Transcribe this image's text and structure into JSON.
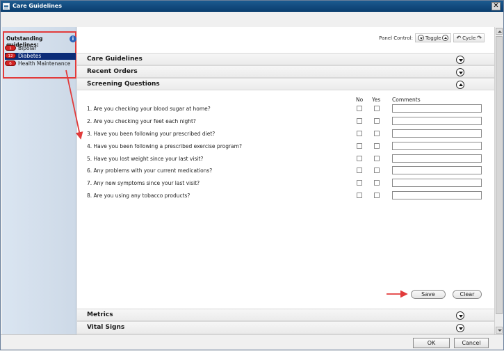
{
  "window": {
    "title": "Care Guidelines",
    "close_glyph": "✕"
  },
  "sidebar": {
    "header": "Outstanding guidelines:",
    "info_glyph": "i",
    "items": [
      {
        "count": "1",
        "label": "Bipolar",
        "selected": false
      },
      {
        "count": "12",
        "label": "Diabetes",
        "selected": true
      },
      {
        "count": "6",
        "label": "Health Maintenance",
        "selected": false
      }
    ]
  },
  "panel_control": {
    "label": "Panel Control:",
    "toggle": "Toggle",
    "cycle": "Cycle"
  },
  "sections": {
    "care_guidelines": "Care Guidelines",
    "recent_orders": "Recent Orders",
    "screening_questions": "Screening Questions",
    "metrics": "Metrics",
    "vital_signs": "Vital Signs"
  },
  "questions_table": {
    "col_no": "No",
    "col_yes": "Yes",
    "col_comments": "Comments",
    "rows": [
      {
        "text": "1. Are you checking your blood sugar at home?",
        "comment": ""
      },
      {
        "text": "2. Are you checking your feet each night?",
        "comment": ""
      },
      {
        "text": "3. Have you been following your prescribed diet?",
        "comment": ""
      },
      {
        "text": "4. Have you been following a prescribed exercise program?",
        "comment": ""
      },
      {
        "text": "5. Have you lost weight since your last visit?",
        "comment": ""
      },
      {
        "text": "6. Any problems with your current medications?",
        "comment": ""
      },
      {
        "text": "7. Any new symptoms since your last visit?",
        "comment": ""
      },
      {
        "text": "8. Are you using any tobacco products?",
        "comment": ""
      }
    ]
  },
  "actions": {
    "save": "Save",
    "clear": "Clear"
  },
  "footer": {
    "ok": "OK",
    "cancel": "Cancel"
  },
  "colors": {
    "title_bar": "#0a3d6e",
    "selection": "#0b2c78",
    "highlight": "#e23b3b",
    "badge": "#d32424"
  }
}
